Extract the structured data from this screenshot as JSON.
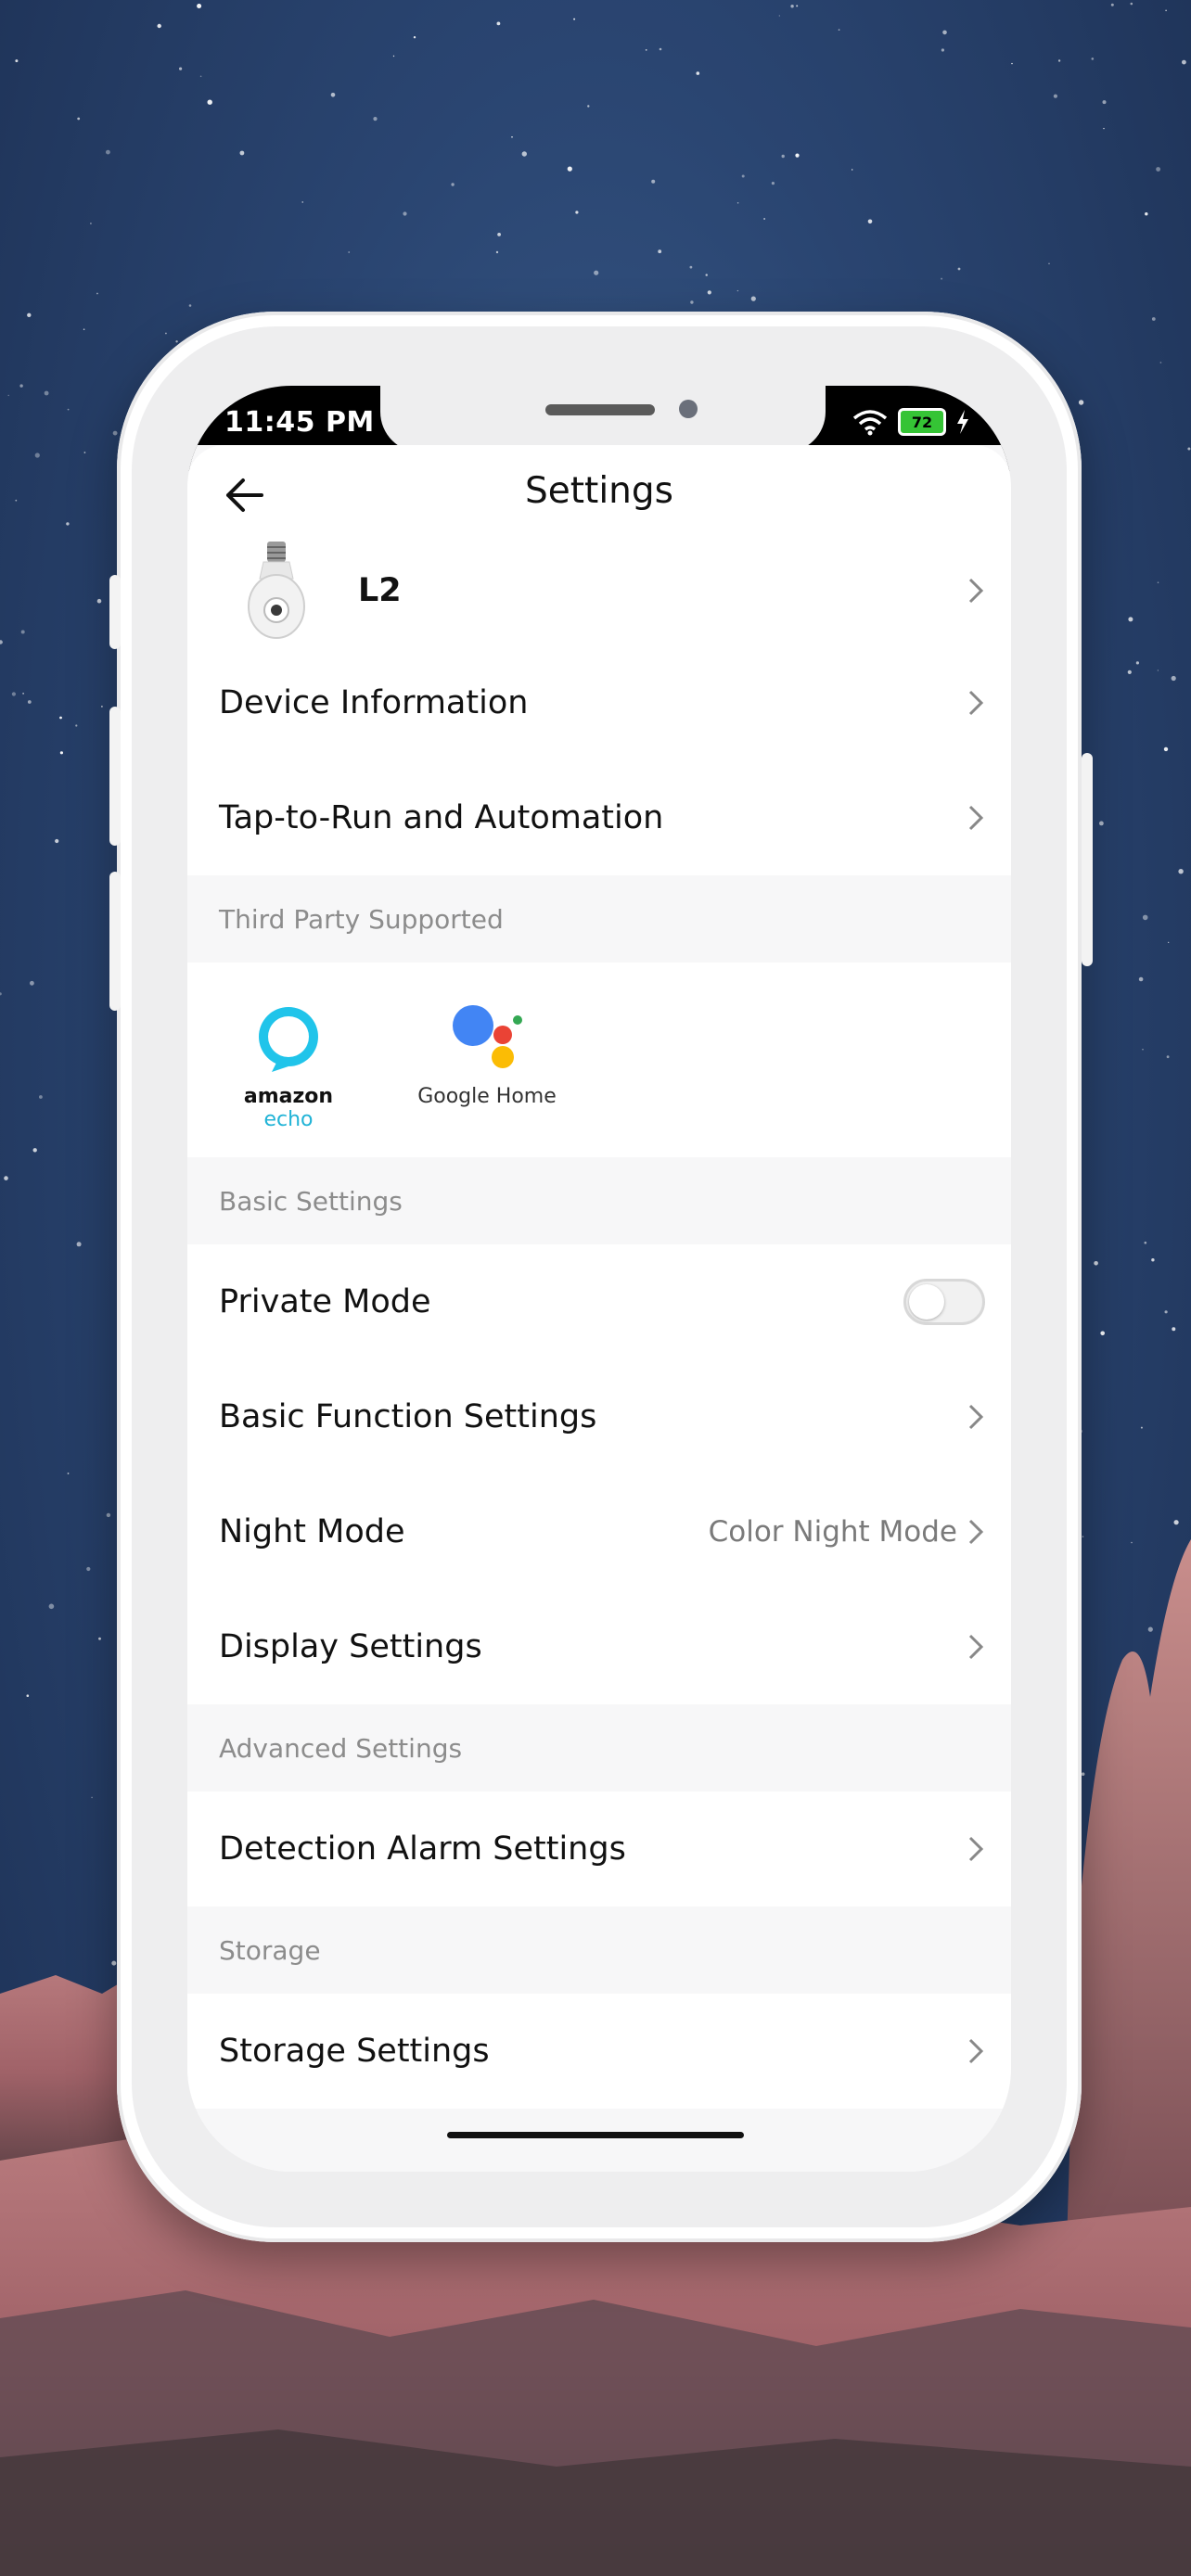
{
  "status_bar": {
    "time": "11:45 PM",
    "battery": "72",
    "icons": [
      "wifi-icon",
      "battery-icon",
      "charging-icon"
    ]
  },
  "header": {
    "title": "Settings",
    "back_icon": "arrow-left-icon"
  },
  "device": {
    "name": "L2",
    "image": "bulb-camera-image"
  },
  "top_items": [
    {
      "label": "Device Information"
    },
    {
      "label": "Tap-to-Run and Automation"
    }
  ],
  "sections": {
    "third_party": "Third Party Supported",
    "basic": "Basic Settings",
    "advanced": "Advanced Settings",
    "storage": "Storage"
  },
  "third_party": {
    "amazon_echo": {
      "word1": "amazon",
      "word2": "echo"
    },
    "google_home": {
      "label": "Google Home"
    }
  },
  "basic_items": {
    "private_mode": {
      "label": "Private Mode",
      "enabled": false
    },
    "basic_function": {
      "label": "Basic Function Settings"
    },
    "night_mode": {
      "label": "Night Mode",
      "value": "Color Night Mode"
    },
    "display": {
      "label": "Display Settings"
    }
  },
  "advanced_items": {
    "detection": {
      "label": "Detection Alarm Settings"
    }
  },
  "storage_items": {
    "storage_settings": {
      "label": "Storage Settings"
    }
  },
  "colors": {
    "accent_echo": "#20b3d6",
    "toggle_off": "#f1f1f1",
    "battery": "#35c435"
  }
}
